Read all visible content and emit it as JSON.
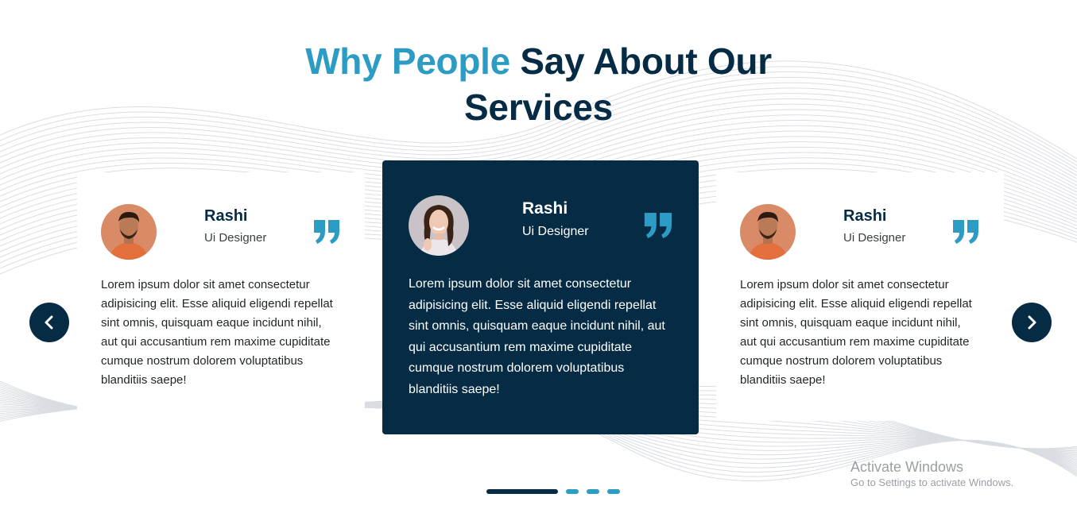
{
  "heading": {
    "accent": "Why People",
    "rest": "Say About Our",
    "line2": "Services"
  },
  "testimonials": [
    {
      "name": "Rashi",
      "role": "Ui Designer",
      "text": "Lorem ipsum dolor sit amet consectetur adipisicing elit. Esse aliquid eligendi repellat sint omnis, quisquam eaque incidunt nihil, aut qui accusantium rem maxime cupiditate cumque nostrum dolorem voluptatibus blanditiis saepe!"
    },
    {
      "name": "Rashi",
      "role": "Ui Designer",
      "text": "Lorem ipsum dolor sit amet consectetur adipisicing elit. Esse aliquid eligendi repellat sint omnis, quisquam eaque incidunt nihil, aut qui accusantium rem maxime cupiditate cumque nostrum dolorem voluptatibus blanditiis saepe!"
    },
    {
      "name": "Rashi",
      "role": "Ui Designer",
      "text": "Lorem ipsum dolor sit amet consectetur adipisicing elit. Esse aliquid eligendi repellat sint omnis, quisquam eaque incidunt nihil, aut qui accusantium rem maxime cupiditate cumque nostrum dolorem voluptatibus blanditiis saepe!"
    }
  ],
  "carousel": {
    "active_index": 0,
    "dot_count": 4,
    "prev_icon": "chevron-left-icon",
    "next_icon": "chevron-right-icon"
  },
  "icons": {
    "quote": "quote-icon",
    "avatar": "avatar"
  },
  "colors": {
    "navy": "#062c45",
    "accent": "#2d9cc4",
    "white": "#ffffff"
  },
  "watermark": {
    "title": "Activate Windows",
    "subtitle": "Go to Settings to activate Windows."
  }
}
